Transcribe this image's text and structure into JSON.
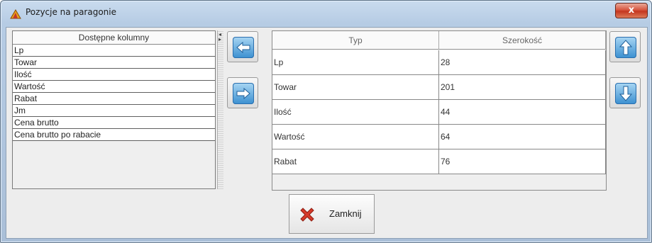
{
  "window": {
    "title": "Pozycje na paragonie",
    "close_glyph": "x",
    "title_icon": "app-icon"
  },
  "available": {
    "header": "Dostępne kolumny",
    "items": [
      "Lp",
      "Towar",
      "Ilość",
      "Wartość",
      "Rabat",
      "Jm",
      "Cena brutto",
      "Cena brutto po rabacie"
    ]
  },
  "buttons": {
    "move_left_icon": "arrow-left-icon",
    "move_right_icon": "arrow-right-icon",
    "move_up_icon": "arrow-up-icon",
    "move_down_icon": "arrow-down-icon",
    "close_label": "Zamknij",
    "close_icon": "red-x-icon"
  },
  "table": {
    "headers": [
      "Typ",
      "Szerokość"
    ],
    "rows": [
      {
        "typ": "Lp",
        "szerokosc": "28"
      },
      {
        "typ": "Towar",
        "szerokosc": "201"
      },
      {
        "typ": "Ilość",
        "szerokosc": "44"
      },
      {
        "typ": "Wartość",
        "szerokosc": "64"
      },
      {
        "typ": "Rabat",
        "szerokosc": "76"
      }
    ]
  },
  "colors": {
    "title_bar": "#c9dbee",
    "close_red": "#c4361f",
    "arrow_blue": "#3a8fd0",
    "background": "#ededed"
  }
}
